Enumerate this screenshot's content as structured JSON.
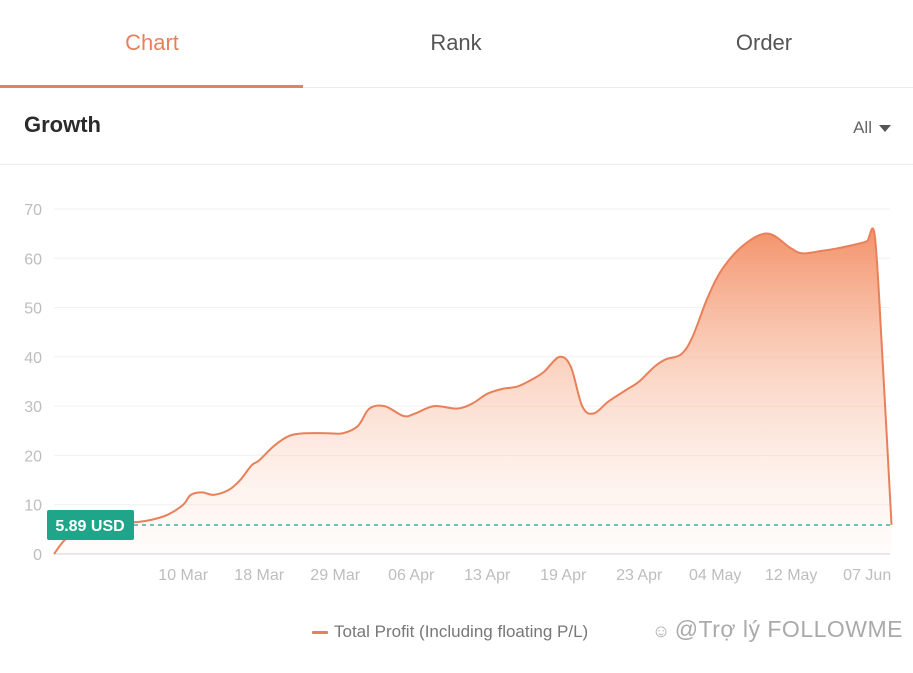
{
  "tabs": [
    {
      "label": "Chart",
      "active": true
    },
    {
      "label": "Rank",
      "active": false
    },
    {
      "label": "Order",
      "active": false
    }
  ],
  "header": {
    "title": "Growth",
    "filter": "All"
  },
  "chart_data": {
    "type": "area",
    "ylim": [
      0,
      70
    ],
    "yticks": [
      0,
      10,
      20,
      30,
      40,
      50,
      60,
      70
    ],
    "x_tick_labels": [
      "10 Mar",
      "18 Mar",
      "29 Mar",
      "06 Apr",
      "13 Apr",
      "19 Apr",
      "23 Apr",
      "04 May",
      "12 May",
      "07 Jun"
    ],
    "x_tick_positions": [
      1,
      2,
      3,
      4,
      5,
      6,
      7,
      8,
      9,
      10
    ],
    "xlim": [
      -0.7,
      10.3
    ],
    "series": [
      {
        "name": "Total Profit (Including floating P/L)",
        "x": [
          -0.7,
          -0.55,
          -0.35,
          -0.1,
          0.2,
          0.4,
          0.6,
          0.8,
          1.0,
          1.1,
          1.25,
          1.4,
          1.6,
          1.75,
          1.9,
          2.0,
          2.2,
          2.4,
          2.6,
          2.9,
          3.1,
          3.3,
          3.45,
          3.65,
          3.9,
          4.05,
          4.3,
          4.6,
          4.8,
          5.0,
          5.2,
          5.4,
          5.6,
          5.75,
          5.95,
          6.1,
          6.25,
          6.4,
          6.6,
          6.85,
          7.0,
          7.2,
          7.35,
          7.55,
          7.7,
          7.9,
          8.1,
          8.4,
          8.7,
          9.0,
          9.15,
          9.4,
          9.6,
          9.9,
          10.0,
          10.1,
          10.2,
          10.32
        ],
        "y": [
          0,
          3,
          5,
          6,
          6.5,
          6.5,
          7,
          8,
          10,
          12,
          12.5,
          12,
          13,
          15,
          18,
          19,
          22,
          24,
          24.5,
          24.5,
          24.5,
          26,
          29.5,
          30,
          28,
          28.5,
          30,
          29.5,
          30.5,
          32.5,
          33.5,
          34,
          35.5,
          37,
          40,
          38,
          30,
          28.5,
          31,
          33.5,
          35,
          38,
          39.5,
          40.5,
          44,
          52,
          58,
          63,
          65,
          62,
          61,
          61.5,
          62,
          63,
          63.5,
          64.5,
          40,
          5.9
        ]
      }
    ],
    "reference_line": {
      "value": 5.89,
      "label": "5.89 USD",
      "color": "#1fa58a"
    },
    "line_color": "#e8805a",
    "legend": "bottom-center"
  },
  "watermark": {
    "logo": "wechat-icon",
    "text": "@Trợ lý FOLLOWME"
  }
}
